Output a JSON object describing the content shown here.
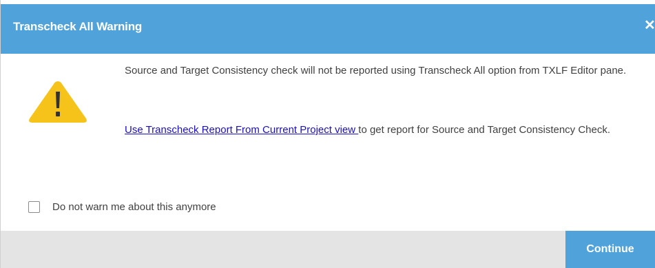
{
  "dialog": {
    "title": "Transcheck All Warning",
    "close_glyph": "✕"
  },
  "message": {
    "icon": "warning-triangle-icon",
    "icon_color": "#f6c31a",
    "paragraph1": "Source and Target Consistency check will not be reported using Transcheck All option from TXLF Editor pane.",
    "link_text": "Use Transcheck Report From Current Project view ",
    "paragraph2_rest": "to get report for Source and Target Consistency Check."
  },
  "checkbox": {
    "label": "Do not warn me about this anymore",
    "checked": false
  },
  "footer": {
    "continue_label": "Continue"
  },
  "colors": {
    "accent": "#4fa3da",
    "link": "#1a0dcc",
    "footer_bg": "#e4e4e4"
  }
}
